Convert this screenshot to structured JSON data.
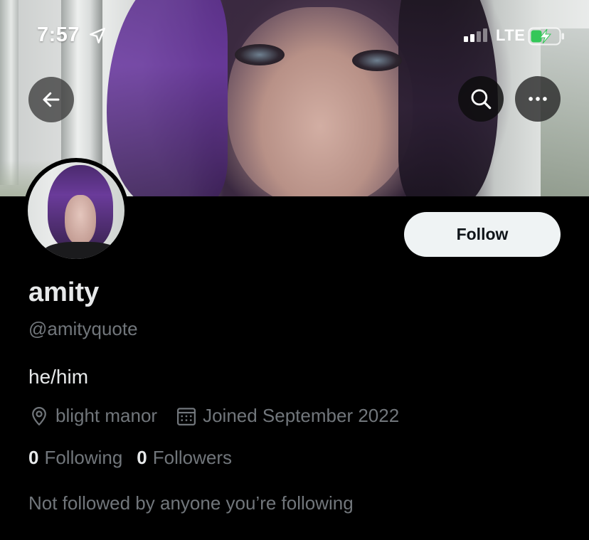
{
  "status_bar": {
    "time": "7:57",
    "network": "LTE",
    "signal_bars_filled": 2,
    "signal_bars_total": 4,
    "battery_state": "charging",
    "battery_color": "#34c759"
  },
  "header": {
    "back_icon": "arrow-left-icon",
    "search_icon": "search-icon",
    "more_icon": "more-horizontal-icon"
  },
  "profile": {
    "display_name": "amity",
    "handle": "@amityquote",
    "bio": "he/him",
    "location": "blight manor",
    "joined": "Joined September 2022",
    "following_count": "0",
    "following_label": "Following",
    "followers_count": "0",
    "followers_label": "Followers",
    "mutuals_note": "Not followed by anyone you’re following"
  },
  "actions": {
    "follow_label": "Follow"
  },
  "colors": {
    "background": "#000000",
    "primary_text": "#e7e9ea",
    "secondary_text": "#71767b",
    "follow_button_bg": "#eff3f4"
  }
}
